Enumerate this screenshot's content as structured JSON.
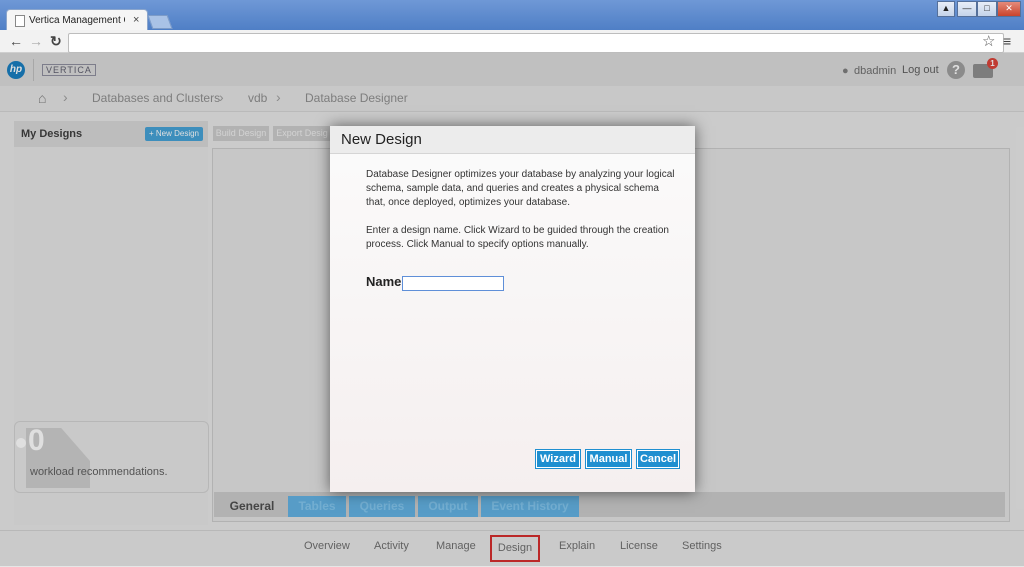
{
  "browser": {
    "tab_title": "Vertica Management Co",
    "tab_close": "×",
    "address": "",
    "window_buttons": [
      "▲",
      "—",
      "□",
      "✕"
    ]
  },
  "header": {
    "brand_hp": "hp",
    "brand_vertica": "VERTICA",
    "username": "dbadmin",
    "logout": "Log out",
    "help": "?",
    "notifications_count": "1"
  },
  "breadcrumb": {
    "items": [
      "Databases and Clusters",
      "vdb",
      "Database Designer"
    ]
  },
  "left_panel": {
    "title": "My Designs",
    "new_design_button": "+ New Design"
  },
  "toolbar": {
    "build_design": "Build Design",
    "export_design": "Export Desig"
  },
  "workload": {
    "count": "0",
    "label": "workload recommendations."
  },
  "bottom_tabs": [
    "General",
    "Tables",
    "Queries",
    "Output",
    "Event History"
  ],
  "footer_nav": [
    "Overview",
    "Activity",
    "Manage",
    "Design",
    "Explain",
    "License",
    "Settings"
  ],
  "dialog": {
    "title": "New Design",
    "paragraph1": "Database Designer optimizes your database by analyzing your logical schema, sample data, and queries and creates a physical schema that, once deployed, optimizes your database.",
    "paragraph2": "Enter a design name. Click Wizard to be guided through the creation process. Click Manual to specify options manually.",
    "name_label": "Name:",
    "name_value": "",
    "wizard": "Wizard",
    "manual": "Manual",
    "cancel": "Cancel"
  },
  "colors": {
    "accent": "#1f8fd0",
    "highlight_border": "#d42020"
  }
}
